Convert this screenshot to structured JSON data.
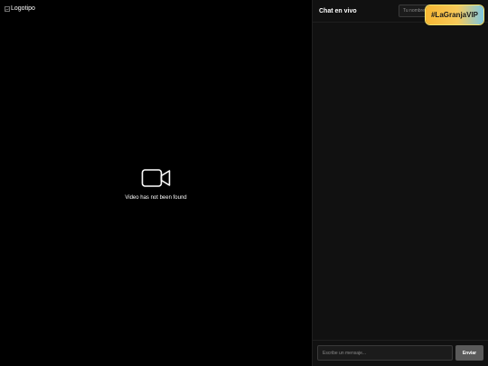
{
  "video": {
    "logo_alt": "Logotipo",
    "not_found_text": "Video has not been found",
    "icon": "video-camera-icon"
  },
  "chat": {
    "title": "Chat en vivo",
    "name_placeholder": "Tu nombre",
    "hashtag": "#LaGranjaVIP",
    "message_placeholder": "Escribe un mensaje...",
    "send_label": "Enviar"
  },
  "colors": {
    "background": "#000000",
    "chat_panel": "#111111",
    "send_button": "#5a5a5a",
    "badge_gradient_start": "#f7b733",
    "badge_gradient_end": "#7ec8e3"
  }
}
